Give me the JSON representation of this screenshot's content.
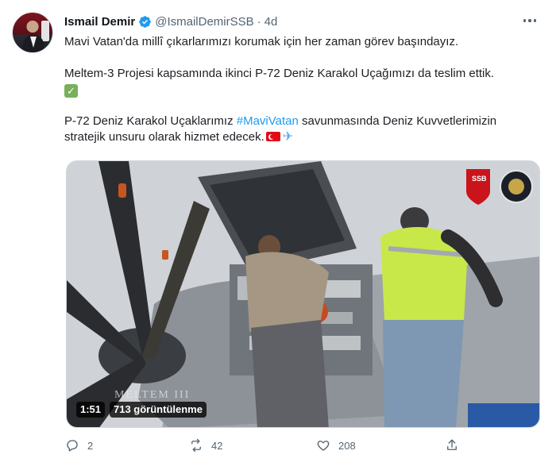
{
  "author": {
    "display_name": "Ismail Demir",
    "handle": "@IsmailDemirSSB",
    "time": "4d",
    "separator": "·"
  },
  "tweet": {
    "line1": "Mavi Vatan'da millî çıkarlarımızı korumak için her zaman görev başındayız.",
    "line2": "Meltem-3 Projesi kapsamında ikinci P-72 Deniz Karakol Uçağımızı da teslim ettik.",
    "line3_before": "P-72 Deniz Karakol Uçaklarımız ",
    "hashtag": "#MaviVatan",
    "line3_after": " savunmasında Deniz Kuvvetlerimizin",
    "line4": "stratejik unsuru olarak hizmet edecek.",
    "check_glyph": "✓"
  },
  "media": {
    "duration": "1:51",
    "views": "713 görüntülenme",
    "watermark": "MELTEM III",
    "logo_left": "SSB"
  },
  "actions": {
    "replies": "2",
    "retweets": "42",
    "likes": "208"
  },
  "colors": {
    "link": "#1d9bf0",
    "muted": "#536471",
    "verified": "#1d9bf0"
  }
}
